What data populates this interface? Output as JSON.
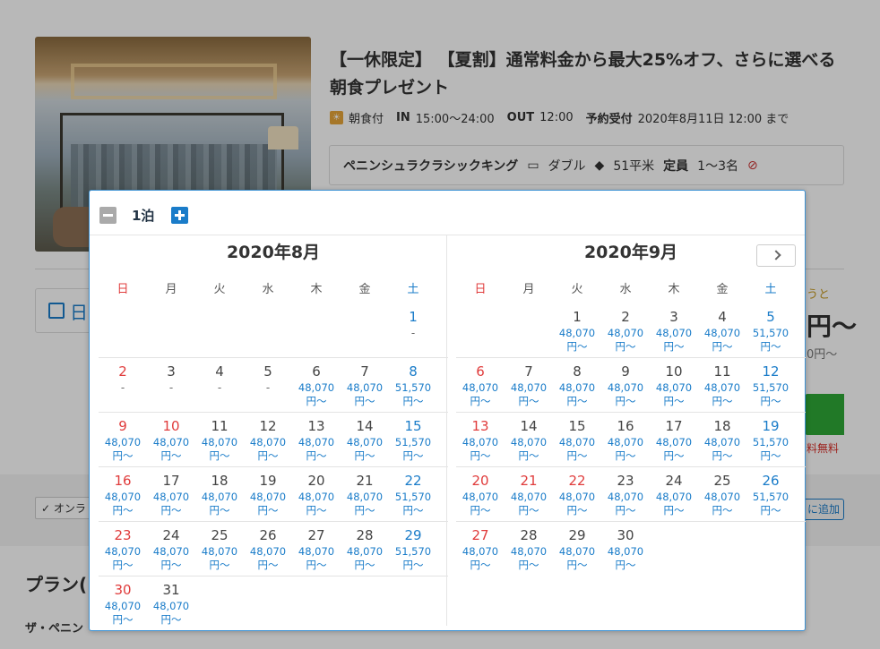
{
  "plan": {
    "title": "【一休限定】 【夏割】通常料金から最大25%オフ、さらに選べる朝食プレゼント",
    "meal": "朝食付",
    "in_label": "IN",
    "in_time": "15:00〜24:00",
    "out_label": "OUT",
    "out_time": "12:00",
    "booking_label": "予約受付",
    "booking_deadline": "2020年8月11日 12:00 まで"
  },
  "room": {
    "name": "ペニンシュラクラシックキング",
    "bed": "ダブル",
    "area": "51平米",
    "capacity_label": "定員",
    "capacity": "1〜3名"
  },
  "background": {
    "date_field_text": "日",
    "promo_text": "うと",
    "price_big": "円〜",
    "price_sub": "0円〜",
    "fee_free": "料無料",
    "online_tag": "✓ オンラ",
    "add_button": "に追加",
    "plan_heading": "プラン(",
    "plan_desc": "ザ・ペニン"
  },
  "nights": {
    "value": "1泊"
  },
  "weekdays": [
    "日",
    "月",
    "火",
    "水",
    "木",
    "金",
    "土"
  ],
  "months": [
    {
      "title": "2020年8月",
      "weeks": [
        [
          null,
          null,
          null,
          null,
          null,
          null,
          {
            "d": "1",
            "p": "-",
            "t": "sat"
          }
        ],
        [
          {
            "d": "2",
            "p": "-",
            "t": "sun"
          },
          {
            "d": "3",
            "p": "-"
          },
          {
            "d": "4",
            "p": "-"
          },
          {
            "d": "5",
            "p": "-"
          },
          {
            "d": "6",
            "p": "48,070\n円〜"
          },
          {
            "d": "7",
            "p": "48,070\n円〜"
          },
          {
            "d": "8",
            "p": "51,570\n円〜",
            "t": "sat"
          }
        ],
        [
          {
            "d": "9",
            "p": "48,070\n円〜",
            "t": "sun"
          },
          {
            "d": "10",
            "p": "48,070\n円〜",
            "t": "hol"
          },
          {
            "d": "11",
            "p": "48,070\n円〜"
          },
          {
            "d": "12",
            "p": "48,070\n円〜"
          },
          {
            "d": "13",
            "p": "48,070\n円〜"
          },
          {
            "d": "14",
            "p": "48,070\n円〜"
          },
          {
            "d": "15",
            "p": "51,570\n円〜",
            "t": "sat"
          }
        ],
        [
          {
            "d": "16",
            "p": "48,070\n円〜",
            "t": "sun"
          },
          {
            "d": "17",
            "p": "48,070\n円〜"
          },
          {
            "d": "18",
            "p": "48,070\n円〜"
          },
          {
            "d": "19",
            "p": "48,070\n円〜"
          },
          {
            "d": "20",
            "p": "48,070\n円〜"
          },
          {
            "d": "21",
            "p": "48,070\n円〜"
          },
          {
            "d": "22",
            "p": "51,570\n円〜",
            "t": "sat"
          }
        ],
        [
          {
            "d": "23",
            "p": "48,070\n円〜",
            "t": "sun"
          },
          {
            "d": "24",
            "p": "48,070\n円〜"
          },
          {
            "d": "25",
            "p": "48,070\n円〜"
          },
          {
            "d": "26",
            "p": "48,070\n円〜"
          },
          {
            "d": "27",
            "p": "48,070\n円〜"
          },
          {
            "d": "28",
            "p": "48,070\n円〜"
          },
          {
            "d": "29",
            "p": "51,570\n円〜",
            "t": "sat"
          }
        ],
        [
          {
            "d": "30",
            "p": "48,070\n円〜",
            "t": "sun"
          },
          {
            "d": "31",
            "p": "48,070\n円〜"
          },
          null,
          null,
          null,
          null,
          null
        ]
      ]
    },
    {
      "title": "2020年9月",
      "weeks": [
        [
          null,
          null,
          {
            "d": "1",
            "p": "48,070\n円〜"
          },
          {
            "d": "2",
            "p": "48,070\n円〜"
          },
          {
            "d": "3",
            "p": "48,070\n円〜"
          },
          {
            "d": "4",
            "p": "48,070\n円〜"
          },
          {
            "d": "5",
            "p": "51,570\n円〜",
            "t": "sat"
          }
        ],
        [
          {
            "d": "6",
            "p": "48,070\n円〜",
            "t": "sun"
          },
          {
            "d": "7",
            "p": "48,070\n円〜"
          },
          {
            "d": "8",
            "p": "48,070\n円〜"
          },
          {
            "d": "9",
            "p": "48,070\n円〜"
          },
          {
            "d": "10",
            "p": "48,070\n円〜"
          },
          {
            "d": "11",
            "p": "48,070\n円〜"
          },
          {
            "d": "12",
            "p": "51,570\n円〜",
            "t": "sat"
          }
        ],
        [
          {
            "d": "13",
            "p": "48,070\n円〜",
            "t": "sun"
          },
          {
            "d": "14",
            "p": "48,070\n円〜"
          },
          {
            "d": "15",
            "p": "48,070\n円〜"
          },
          {
            "d": "16",
            "p": "48,070\n円〜"
          },
          {
            "d": "17",
            "p": "48,070\n円〜"
          },
          {
            "d": "18",
            "p": "48,070\n円〜"
          },
          {
            "d": "19",
            "p": "51,570\n円〜",
            "t": "sat"
          }
        ],
        [
          {
            "d": "20",
            "p": "48,070\n円〜",
            "t": "sun"
          },
          {
            "d": "21",
            "p": "48,070\n円〜",
            "t": "hol"
          },
          {
            "d": "22",
            "p": "48,070\n円〜",
            "t": "hol"
          },
          {
            "d": "23",
            "p": "48,070\n円〜"
          },
          {
            "d": "24",
            "p": "48,070\n円〜"
          },
          {
            "d": "25",
            "p": "48,070\n円〜"
          },
          {
            "d": "26",
            "p": "51,570\n円〜",
            "t": "sat"
          }
        ],
        [
          {
            "d": "27",
            "p": "48,070\n円〜",
            "t": "sun"
          },
          {
            "d": "28",
            "p": "48,070\n円〜"
          },
          {
            "d": "29",
            "p": "48,070\n円〜"
          },
          {
            "d": "30",
            "p": "48,070\n円〜"
          },
          null,
          null,
          null
        ]
      ]
    }
  ],
  "colors": {
    "accent": "#1a7cc9",
    "sunday_holiday": "#e03c3c",
    "saturday": "#1a7cc9",
    "book_button": "#2ea836"
  }
}
